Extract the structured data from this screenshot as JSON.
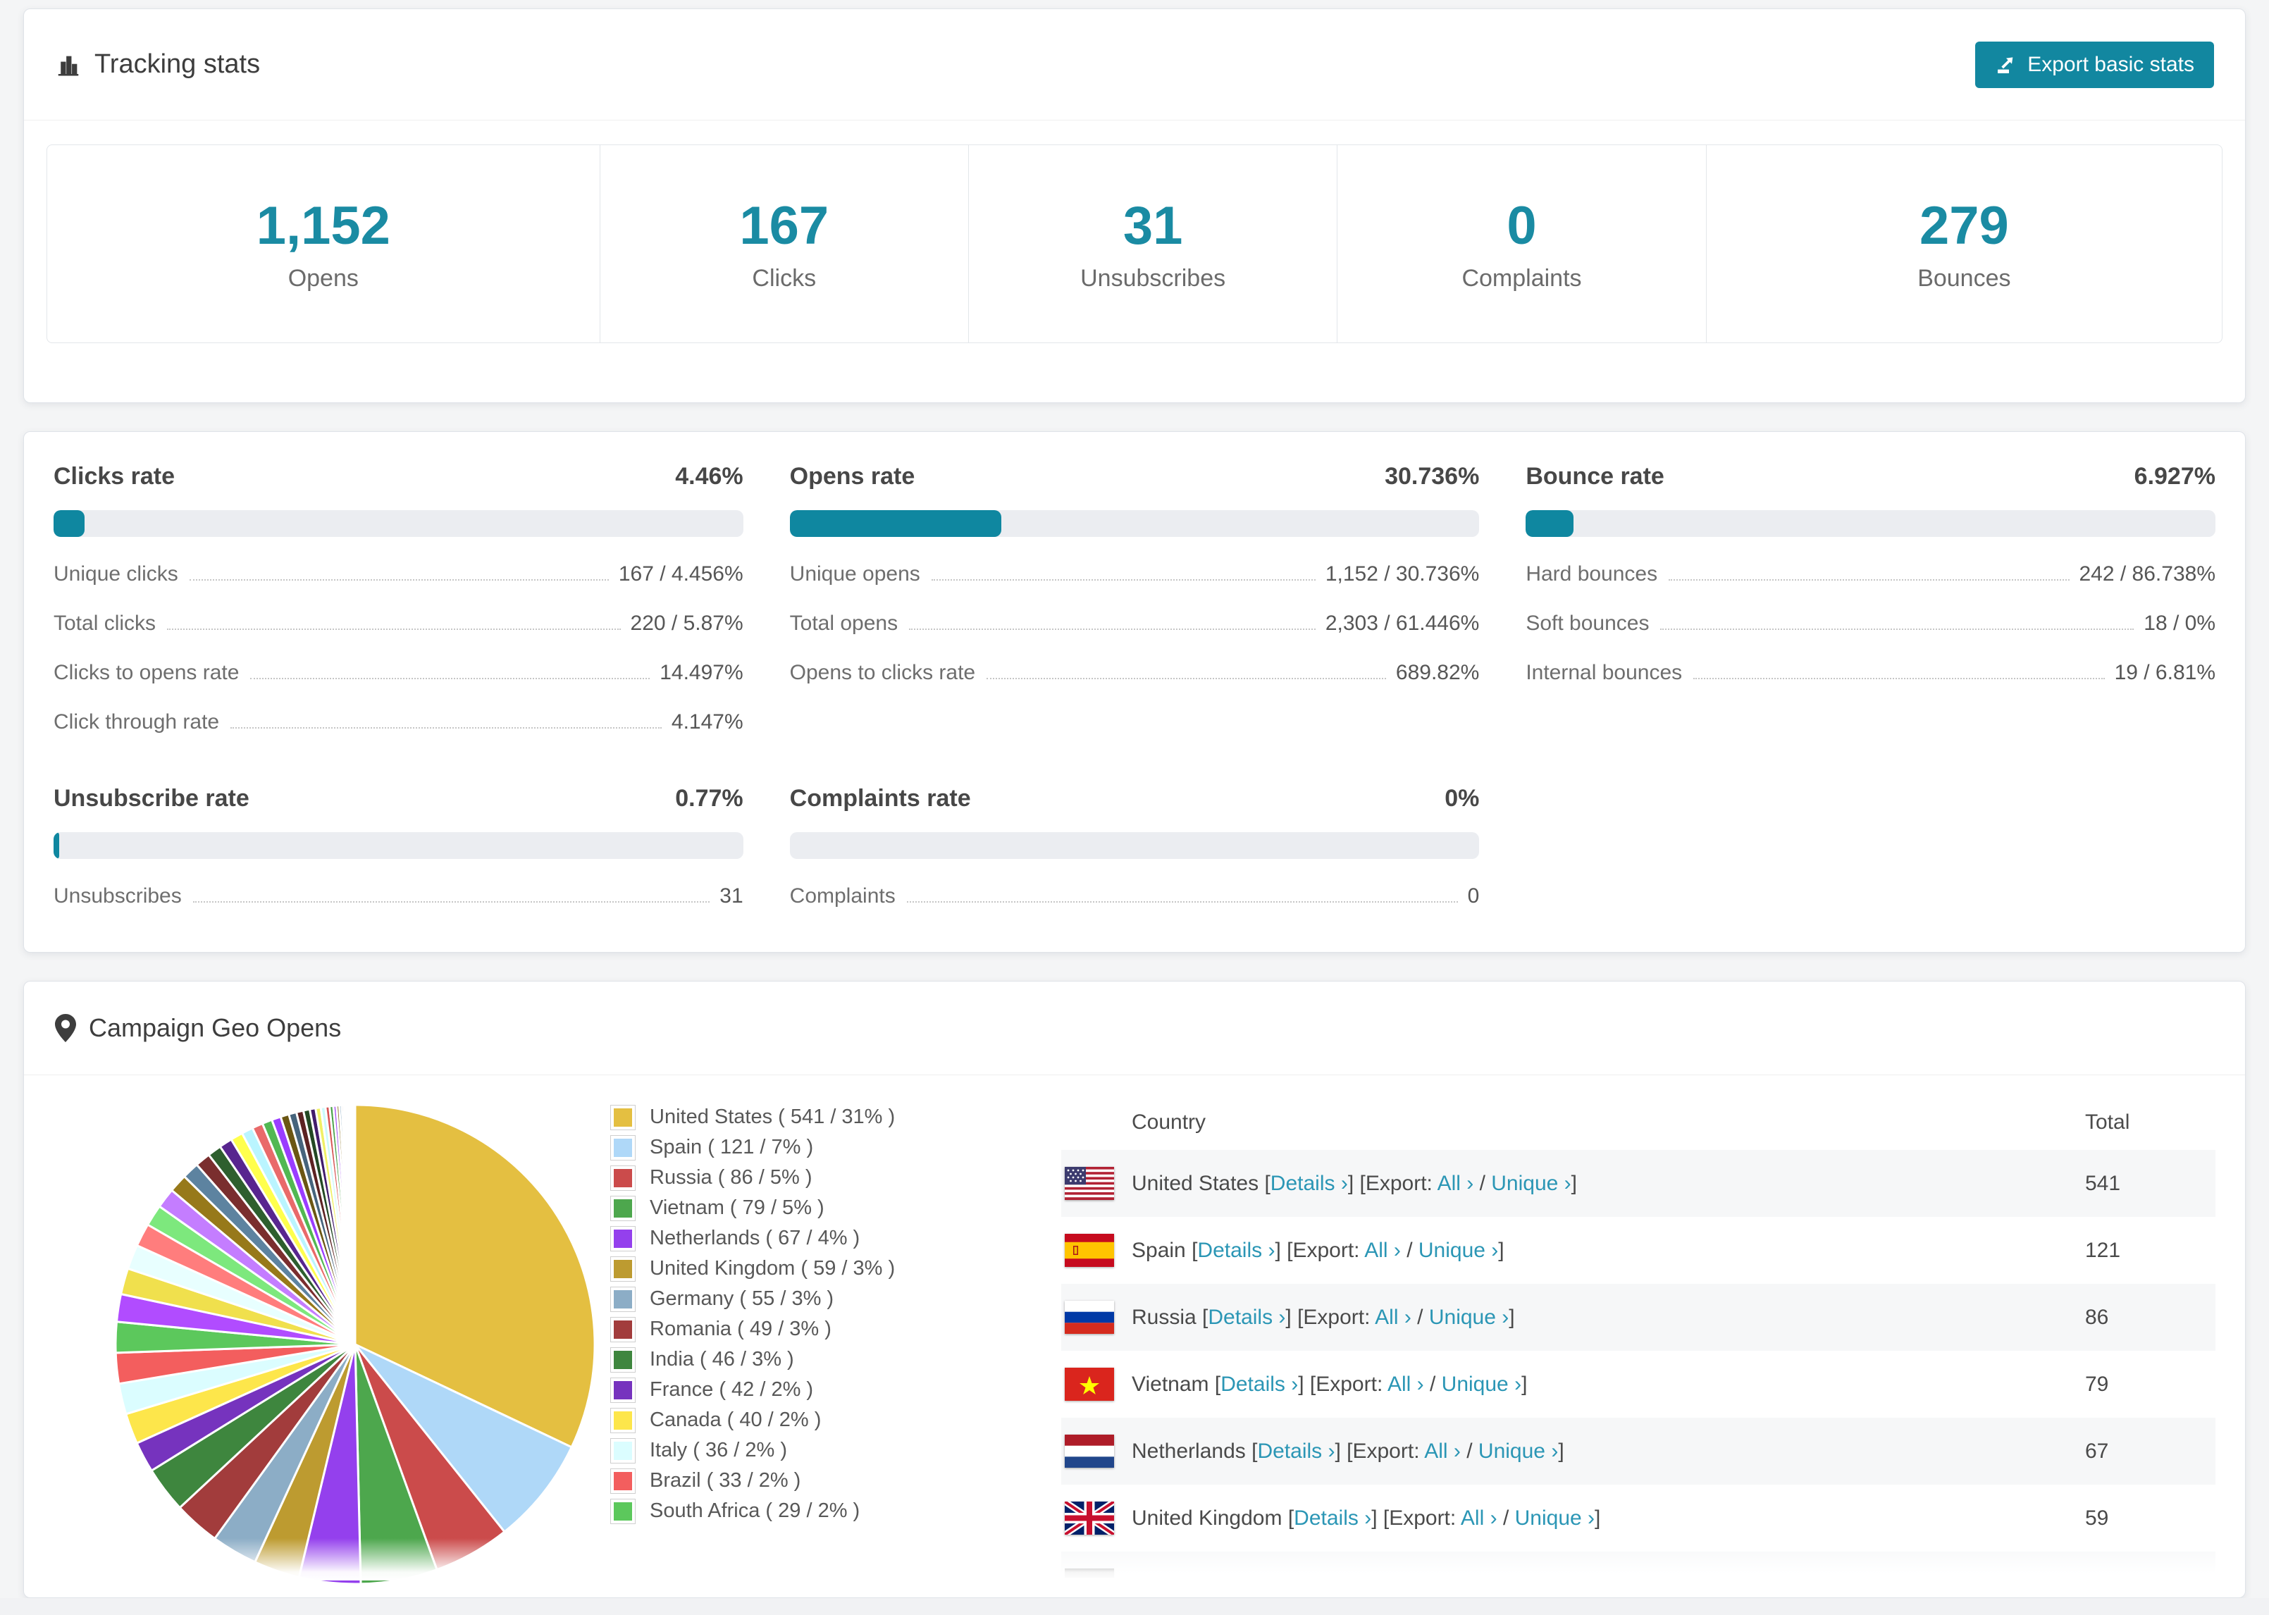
{
  "tracking": {
    "title": "Tracking stats",
    "export_label": "Export basic stats"
  },
  "summary": {
    "cards": [
      {
        "value": "1,152",
        "label": "Opens"
      },
      {
        "value": "167",
        "label": "Clicks"
      },
      {
        "value": "31",
        "label": "Unsubscribes"
      },
      {
        "value": "0",
        "label": "Complaints"
      },
      {
        "value": "279",
        "label": "Bounces"
      }
    ]
  },
  "rates": {
    "clicks": {
      "title": "Clicks rate",
      "value": "4.46%",
      "bar_pct": 4.46,
      "rows": [
        {
          "label": "Unique clicks",
          "value": "167 / 4.456%"
        },
        {
          "label": "Total clicks",
          "value": "220 / 5.87%"
        },
        {
          "label": "Clicks to opens rate",
          "value": "14.497%"
        },
        {
          "label": "Click through rate",
          "value": "4.147%"
        }
      ]
    },
    "opens": {
      "title": "Opens rate",
      "value": "30.736%",
      "bar_pct": 30.736,
      "rows": [
        {
          "label": "Unique opens",
          "value": "1,152 / 30.736%"
        },
        {
          "label": "Total opens",
          "value": "2,303 / 61.446%"
        },
        {
          "label": "Opens to clicks rate",
          "value": "689.82%"
        }
      ]
    },
    "bounce": {
      "title": "Bounce rate",
      "value": "6.927%",
      "bar_pct": 6.927,
      "rows": [
        {
          "label": "Hard bounces",
          "value": "242 / 86.738%"
        },
        {
          "label": "Soft bounces",
          "value": "18 / 0%"
        },
        {
          "label": "Internal bounces",
          "value": "19 / 6.81%"
        }
      ]
    },
    "unsubscribe": {
      "title": "Unsubscribe rate",
      "value": "0.77%",
      "bar_pct": 0.77,
      "rows": [
        {
          "label": "Unsubscribes",
          "value": "31"
        }
      ]
    },
    "complaints": {
      "title": "Complaints rate",
      "value": "0%",
      "bar_pct": 0,
      "rows": [
        {
          "label": "Complaints",
          "value": "0"
        }
      ]
    }
  },
  "geo": {
    "title": "Campaign Geo Opens",
    "table": {
      "headers": {
        "country": "Country",
        "total": "Total"
      },
      "link_labels": {
        "lb": "[",
        "details": "Details ›",
        "mid": "] [Export:",
        "all": "All ›",
        "slash": "/",
        "unique": "Unique ›",
        "rb": "]"
      },
      "rows": [
        {
          "country": "United States",
          "total": "541",
          "flag": "us"
        },
        {
          "country": "Spain",
          "total": "121",
          "flag": "es"
        },
        {
          "country": "Russia",
          "total": "86",
          "flag": "ru"
        },
        {
          "country": "Vietnam",
          "total": "79",
          "flag": "vn"
        },
        {
          "country": "Netherlands",
          "total": "67",
          "flag": "nl"
        },
        {
          "country": "United Kingdom",
          "total": "59",
          "flag": "gb"
        },
        {
          "country": "",
          "total": "",
          "flag": "de",
          "partial": true
        }
      ]
    }
  },
  "chart_data": {
    "type": "pie",
    "title": "Campaign Geo Opens",
    "legend_position": "right",
    "start_angle_deg": -90,
    "direction": "clockwise",
    "slices": [
      {
        "name": "United States",
        "count": 541,
        "pct": "31%",
        "pct_value": 31,
        "color": "#e4bf41",
        "label": "United States ( 541 / 31% )"
      },
      {
        "name": "Spain",
        "count": 121,
        "pct": "7%",
        "pct_value": 7,
        "color": "#afd8f8",
        "label": "Spain ( 121 / 7% )"
      },
      {
        "name": "Russia",
        "count": 86,
        "pct": "5%",
        "pct_value": 5,
        "color": "#cb4b4b",
        "label": "Russia ( 86 / 5% )"
      },
      {
        "name": "Vietnam",
        "count": 79,
        "pct": "5%",
        "pct_value": 5,
        "color": "#4da74d",
        "label": "Vietnam ( 79 / 5% )"
      },
      {
        "name": "Netherlands",
        "count": 67,
        "pct": "4%",
        "pct_value": 4,
        "color": "#9440ed",
        "label": "Netherlands ( 67 / 4% )"
      },
      {
        "name": "United Kingdom",
        "count": 59,
        "pct": "3%",
        "pct_value": 3,
        "color": "#bd9b30",
        "label": "United Kingdom ( 59 / 3% )"
      },
      {
        "name": "Germany",
        "count": 55,
        "pct": "3%",
        "pct_value": 3,
        "color": "#8cadc6",
        "label": "Germany ( 55 / 3% )"
      },
      {
        "name": "Romania",
        "count": 49,
        "pct": "3%",
        "pct_value": 3,
        "color": "#a23c3c",
        "label": "Romania ( 49 / 3% )"
      },
      {
        "name": "India",
        "count": 46,
        "pct": "3%",
        "pct_value": 3,
        "color": "#3e863e",
        "label": "India ( 46 / 3% )"
      },
      {
        "name": "France",
        "count": 42,
        "pct": "2%",
        "pct_value": 2,
        "color": "#7633be",
        "label": "France ( 42 / 2% )"
      },
      {
        "name": "Canada",
        "count": 40,
        "pct": "2%",
        "pct_value": 2,
        "color": "#fde64b",
        "label": "Canada ( 40 / 2% )"
      },
      {
        "name": "Italy",
        "count": 36,
        "pct": "2%",
        "pct_value": 2,
        "color": "#dbfdff",
        "label": "Italy ( 36 / 2% )"
      },
      {
        "name": "Brazil",
        "count": 33,
        "pct": "2%",
        "pct_value": 2,
        "color": "#f35e5e",
        "label": "Brazil ( 33 / 2% )"
      },
      {
        "name": "South Africa",
        "count": 29,
        "pct": "2%",
        "pct_value": 2,
        "color": "#5cc85c",
        "label": "South Africa ( 29 / 2% )"
      }
    ],
    "others_note": "unlabeled small slices, sizes estimated from pixels",
    "others": [
      {
        "value": 1.8,
        "color": "#b14cff"
      },
      {
        "value": 1.7,
        "color": "#f0e04d"
      },
      {
        "value": 1.6,
        "color": "#e8ffff"
      },
      {
        "value": 1.5,
        "color": "#ff7d7d"
      },
      {
        "value": 1.4,
        "color": "#7de87d"
      },
      {
        "value": 1.3,
        "color": "#c47dff"
      },
      {
        "value": 1.2,
        "color": "#97791a"
      },
      {
        "value": 1.1,
        "color": "#5d83a0"
      },
      {
        "value": 1.0,
        "color": "#7a2e2e"
      },
      {
        "value": 0.9,
        "color": "#2e5f2e"
      },
      {
        "value": 0.85,
        "color": "#58258f"
      },
      {
        "value": 0.8,
        "color": "#ffff4d"
      },
      {
        "value": 0.75,
        "color": "#baf5ff"
      },
      {
        "value": 0.7,
        "color": "#e96a6a"
      },
      {
        "value": 0.65,
        "color": "#52b852"
      },
      {
        "value": 0.6,
        "color": "#9a3dff"
      },
      {
        "value": 0.55,
        "color": "#6b5613"
      },
      {
        "value": 0.5,
        "color": "#46647c"
      },
      {
        "value": 0.46,
        "color": "#5c2222"
      },
      {
        "value": 0.42,
        "color": "#234823"
      },
      {
        "value": 0.38,
        "color": "#421c6b"
      },
      {
        "value": 0.34,
        "color": "#f0f065"
      },
      {
        "value": 0.3,
        "color": "#ccfafa"
      },
      {
        "value": 0.27,
        "color": "#d65252"
      },
      {
        "value": 0.24,
        "color": "#46a046"
      },
      {
        "value": 0.21,
        "color": "#a855f5"
      },
      {
        "value": 0.18,
        "color": "#8a701e"
      },
      {
        "value": 0.16,
        "color": "#6d96b5"
      },
      {
        "value": 0.14,
        "color": "#8f3a3a"
      },
      {
        "value": 0.12,
        "color": "#376e37"
      },
      {
        "value": 0.1,
        "color": "#6b2ba8"
      },
      {
        "value": 0.09,
        "color": "#ffef80"
      },
      {
        "value": 0.08,
        "color": "#d5ffff"
      },
      {
        "value": 0.07,
        "color": "#ff9090"
      },
      {
        "value": 0.06,
        "color": "#90ee90"
      },
      {
        "value": 0.05,
        "color": "#d090ff"
      },
      {
        "value": 0.045,
        "color": "#b09020"
      },
      {
        "value": 0.04,
        "color": "#7fa8c0"
      },
      {
        "value": 0.035,
        "color": "#a04848"
      },
      {
        "value": 0.03,
        "color": "#4a8a4a"
      }
    ]
  }
}
